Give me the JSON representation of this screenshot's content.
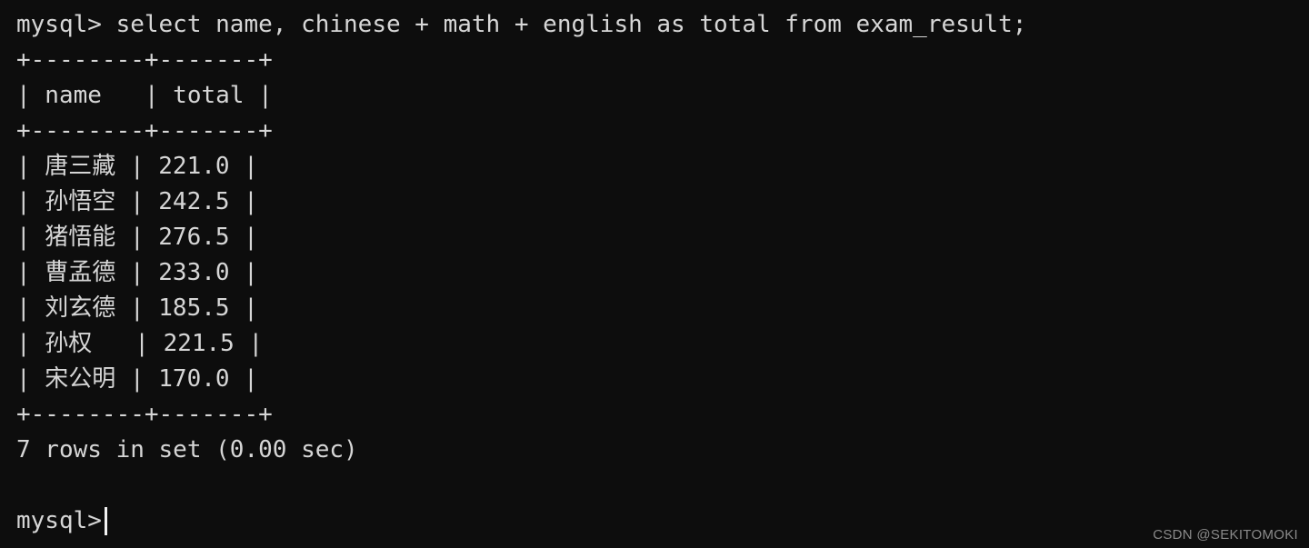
{
  "terminal": {
    "background_color": "#0d0d0d",
    "foreground_color": "#d6d6d6",
    "cursor_color": "#f2f2f2",
    "prompt": "mysql>",
    "command_line": "mysql> select name, chinese + math + english as total from exam_result;",
    "border_top": "+--------+-------+",
    "header_row": "| name   | total |",
    "border_mid": "+--------+-------+",
    "rows": [
      "| 唐三藏 | 221.0 |",
      "| 孙悟空 | 242.5 |",
      "| 猪悟能 | 276.5 |",
      "| 曹孟德 | 233.0 |",
      "| 刘玄德 | 185.5 |",
      "| 孙权   | 221.5 |",
      "| 宋公明 | 170.0 |"
    ],
    "border_bottom": "+--------+-------+",
    "status_line": "7 rows in set (0.00 sec)",
    "blank_line": " ",
    "final_prompt": "mysql> "
  },
  "table": {
    "columns": [
      "name",
      "total"
    ],
    "records": [
      {
        "name": "唐三藏",
        "total": "221.0"
      },
      {
        "name": "孙悟空",
        "total": "242.5"
      },
      {
        "name": "猪悟能",
        "total": "276.5"
      },
      {
        "name": "曹孟德",
        "total": "233.0"
      },
      {
        "name": "刘玄德",
        "total": "185.5"
      },
      {
        "name": "孙权",
        "total": "221.5"
      },
      {
        "name": "宋公明",
        "total": "170.0"
      }
    ],
    "row_count": 7,
    "elapsed": "0.00 sec"
  },
  "watermark": {
    "text": "CSDN @SEKITOMOKI"
  }
}
